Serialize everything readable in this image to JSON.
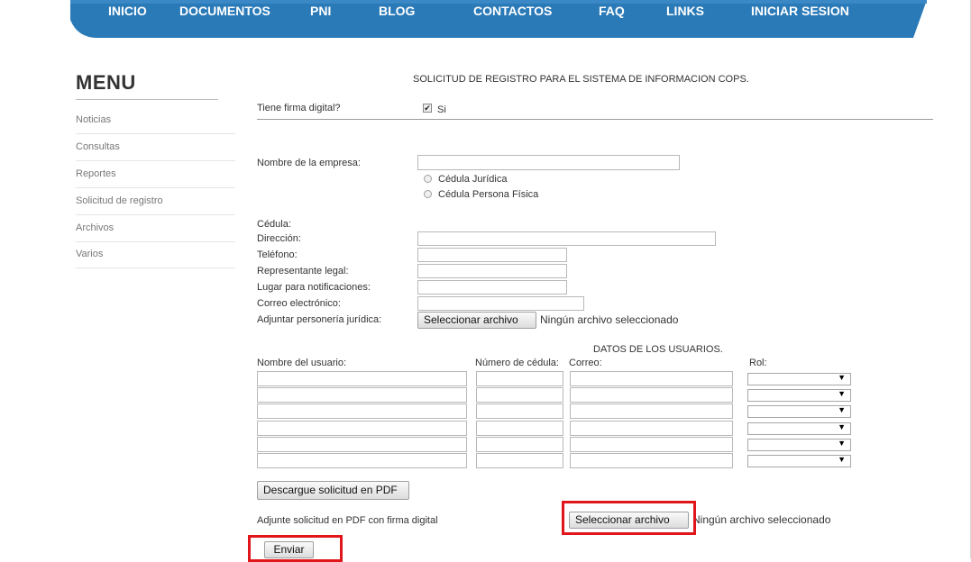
{
  "nav": {
    "items": [
      "INICIO",
      "DOCUMENTOS",
      "PNI",
      "BLOG",
      "CONTACTOS",
      "FAQ",
      "LINKS",
      "INICIAR SESION"
    ],
    "color": "#2a7ab8"
  },
  "sidebar": {
    "title": "MENU",
    "items": [
      "Noticias",
      "Consultas",
      "Reportes",
      "Solicitud de registro",
      "Archivos",
      "Varios"
    ]
  },
  "form": {
    "heading": "SOLICITUD DE REGISTRO PARA EL SISTEMA DE INFORMACION COPS.",
    "firma_label": "Tiene firma digital?",
    "firma_value": "Si",
    "firma_checked": true,
    "empresa_label": "Nombre de la empresa:",
    "cedula_options": [
      "Cédula Jurídica",
      "Cédula Persona Física"
    ],
    "cedula_label": "Cédula:",
    "direccion_label": "Dirección:",
    "telefono_label": "Teléfono:",
    "representante_label": "Representante legal:",
    "notificaciones_label": "Lugar para notificaciones:",
    "correo_label": "Correo electrónico:",
    "adjuntar_label": "Adjuntar personería jurídica:",
    "file_button": "Seleccionar archivo",
    "file_status": "Ningún archivo seleccionado"
  },
  "users": {
    "heading": "DATOS DE LOS USUARIOS.",
    "col_nombre": "Nombre del usuario:",
    "col_cedula": "Número de cédula:",
    "col_correo": "Correo:",
    "col_rol": "Rol:",
    "row_count": 6
  },
  "footer": {
    "download_button": "Descargue solicitud en PDF",
    "attach_label": "Adjunte solicitud en PDF con firma digital",
    "file_button": "Seleccionar archivo",
    "file_status": "Ningún archivo seleccionado",
    "submit_button": "Enviar",
    "highlight_color": "#e0161b"
  }
}
